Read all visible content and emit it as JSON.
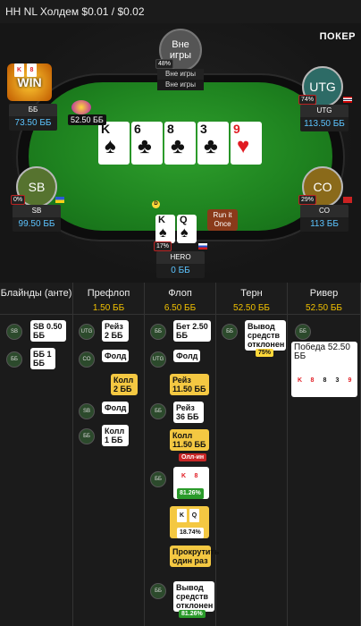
{
  "header": {
    "title": "HH NL Холдем $0.01 / $0.02"
  },
  "brand": "ПОКЕР",
  "board": [
    {
      "rank": "K",
      "suit": "♠",
      "color": "black"
    },
    {
      "rank": "6",
      "suit": "♣",
      "color": "black"
    },
    {
      "rank": "8",
      "suit": "♣",
      "color": "black"
    },
    {
      "rank": "3",
      "suit": "♣",
      "color": "black"
    },
    {
      "rank": "9",
      "suit": "♥",
      "color": "red"
    }
  ],
  "seats": {
    "top": {
      "status": "Вне игры",
      "line1": "Вне игры",
      "line2": "Вне игры",
      "pct": "48%",
      "avatar_label": "Вне игры"
    },
    "bb": {
      "name": "ББ",
      "stack": "73.50 ББ",
      "avatar_label": "WIN",
      "hand": [
        "K",
        "8"
      ]
    },
    "utg": {
      "name": "UTG",
      "stack": "113.50 ББ",
      "pct": "74%",
      "avatar_label": "UTG"
    },
    "sb": {
      "name": "SB",
      "stack": "99.50 ББ",
      "pct": "0%",
      "avatar_label": "SB"
    },
    "co": {
      "name": "CO",
      "stack": "113 ББ",
      "pct": "29%",
      "avatar_label": "CO"
    },
    "hero": {
      "name": "HERO",
      "stack": "0 ББ",
      "pct": "17%",
      "hand": [
        "K",
        "Q"
      ]
    }
  },
  "pot_label": "52.50 ББ",
  "run_it_once": "Run it Once",
  "dealer_button": "D",
  "history": {
    "columns": [
      {
        "title": "Блайнды (анте)",
        "value": ""
      },
      {
        "title": "Префлоп",
        "value": "1.50 ББ"
      },
      {
        "title": "Флоп",
        "value": "6.50 ББ"
      },
      {
        "title": "Терн",
        "value": "52.50 ББ"
      },
      {
        "title": "Ривер",
        "value": "52.50 ББ"
      }
    ],
    "blinds": [
      {
        "pos": "SB",
        "text": "SB 0.50 ББ"
      },
      {
        "pos": "ББ",
        "text": "ББ 1 ББ"
      }
    ],
    "preflop": [
      {
        "pos": "UTG",
        "text": "Рейз 2 ББ"
      },
      {
        "pos": "CO",
        "text": "Фолд"
      },
      {
        "pos": "",
        "text": "Колл 2 ББ"
      },
      {
        "pos": "SB",
        "text": "Фолд"
      },
      {
        "pos": "ББ",
        "text": "Колл 1 ББ"
      }
    ],
    "flop": [
      {
        "pos": "ББ",
        "text": "Бет 2.50 ББ"
      },
      {
        "pos": "UTG",
        "text": "Фолд"
      },
      {
        "pos": "",
        "text": "Рейз 11.50 ББ"
      },
      {
        "pos": "ББ",
        "text": "Рейз 36 ББ"
      },
      {
        "pos": "",
        "text": "Колл 11.50 ББ",
        "tag": "Олл-ин"
      },
      {
        "pos": "ББ",
        "tag": "81.26%"
      },
      {
        "pos": "",
        "tag": "18.74%"
      },
      {
        "pos": "",
        "text": "Прокрутить один раз"
      },
      {
        "pos": "ББ",
        "text": "Вывод средств отклонен",
        "tag": "81.26%"
      }
    ],
    "turn": [
      {
        "pos": "ББ",
        "text": "Вывод средств отклонен",
        "tag": "75%"
      }
    ],
    "river": {
      "pos": "ББ",
      "text": "Победа 52.50 ББ"
    }
  }
}
